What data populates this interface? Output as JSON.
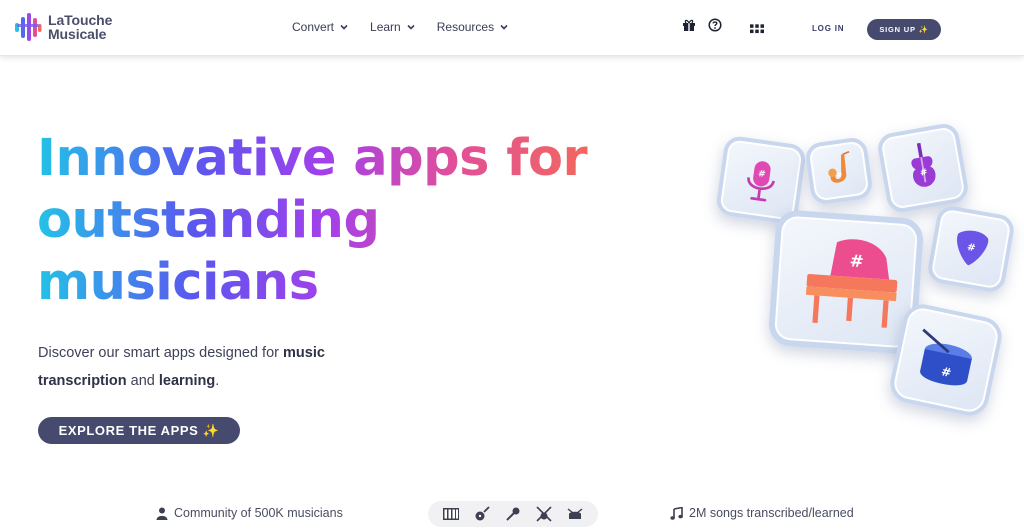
{
  "brand": {
    "line1": "LaTouche",
    "line2": "Musicale",
    "logo_icon": "sound-wave-logo-icon"
  },
  "nav": {
    "items": [
      {
        "label": "Convert",
        "icon": "chevron-down-icon"
      },
      {
        "label": "Learn",
        "icon": "chevron-down-icon"
      },
      {
        "label": "Resources",
        "icon": "chevron-down-icon"
      }
    ],
    "icons": [
      "gift-icon",
      "help-icon",
      "apps-grid-icon"
    ],
    "login_label": "LOG IN",
    "signup_label": "SIGN UP ✨"
  },
  "hero": {
    "headline": [
      "Innovative apps for",
      "outstanding",
      "musicians"
    ],
    "subtitle": {
      "part1": "Discover our smart apps designed for ",
      "bold1": "music",
      "bold2": "transcription",
      "part2": " and ",
      "bold3": "learning",
      "part3": "."
    },
    "cta_label": "EXPLORE THE APPS ✨"
  },
  "illustration": {
    "tiles": [
      "microphone-tile",
      "saxophone-tile",
      "violin-tile",
      "piano-tile",
      "guitar-pick-tile",
      "drum-tile"
    ]
  },
  "stats": {
    "community": "Community of 500K musicians",
    "songs": "2M songs transcribed/learned",
    "instrument_icons": [
      "piano-icon",
      "guitar-icon",
      "microphone-icon",
      "bass-icon",
      "drums-icon"
    ]
  },
  "colors": {
    "accent_dark": "#454a6e",
    "gradient": [
      "#22c3e6",
      "#5a57ef",
      "#a440ea",
      "#e04f9a",
      "#f3695a"
    ]
  }
}
